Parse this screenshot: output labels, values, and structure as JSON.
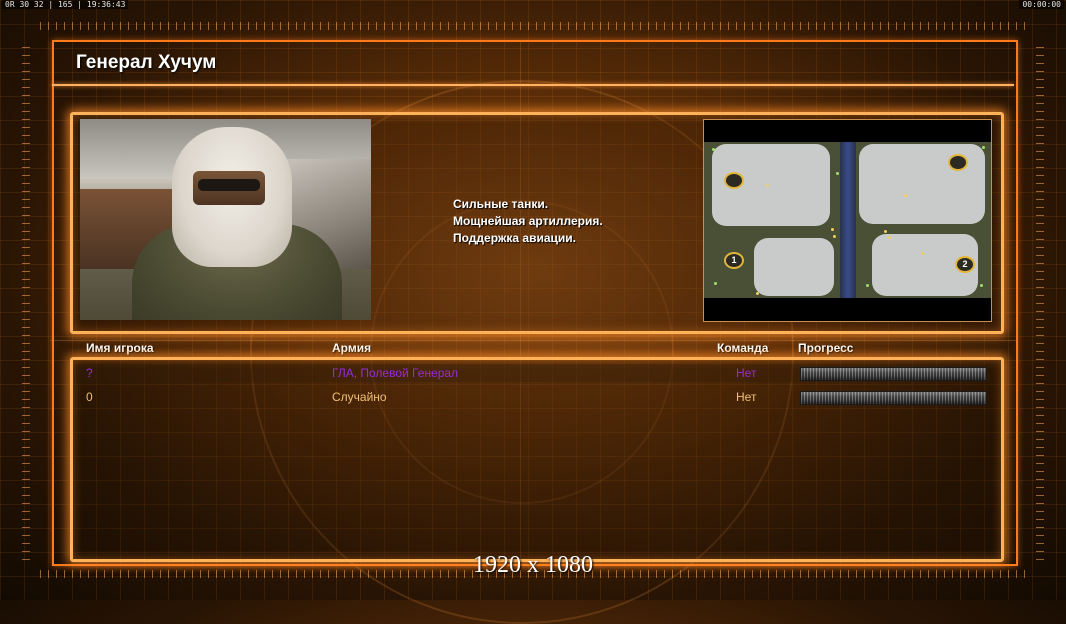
{
  "hud": {
    "left_text": "0R 30 32 | 165 | 19:36:43",
    "right_text": "00:00:00"
  },
  "general": {
    "title": "Генерал Хучум",
    "description_lines": [
      "Сильные танки.",
      "Мощнейшая артиллерия.",
      "Поддержка авиации."
    ]
  },
  "map": {
    "bases": [
      "1",
      "2"
    ]
  },
  "players_table": {
    "columns": [
      "Имя игрока",
      "Армия",
      "Команда",
      "Прогресс"
    ],
    "rows": [
      {
        "name": "?",
        "army": "ГЛА, Полевой Генерал",
        "team": "Нет",
        "progress": 0,
        "color": "#9a2ad8"
      },
      {
        "name": "0",
        "army": "Случайно",
        "team": "Нет",
        "progress": 0,
        "color": "#f0c078"
      }
    ]
  },
  "resolution_label": "1920 x 1080",
  "colors": {
    "accent": "#ff7a1a",
    "panel_glow": "#ffb25a",
    "player_purple": "#9a2ad8",
    "player_orange": "#f0c078"
  }
}
